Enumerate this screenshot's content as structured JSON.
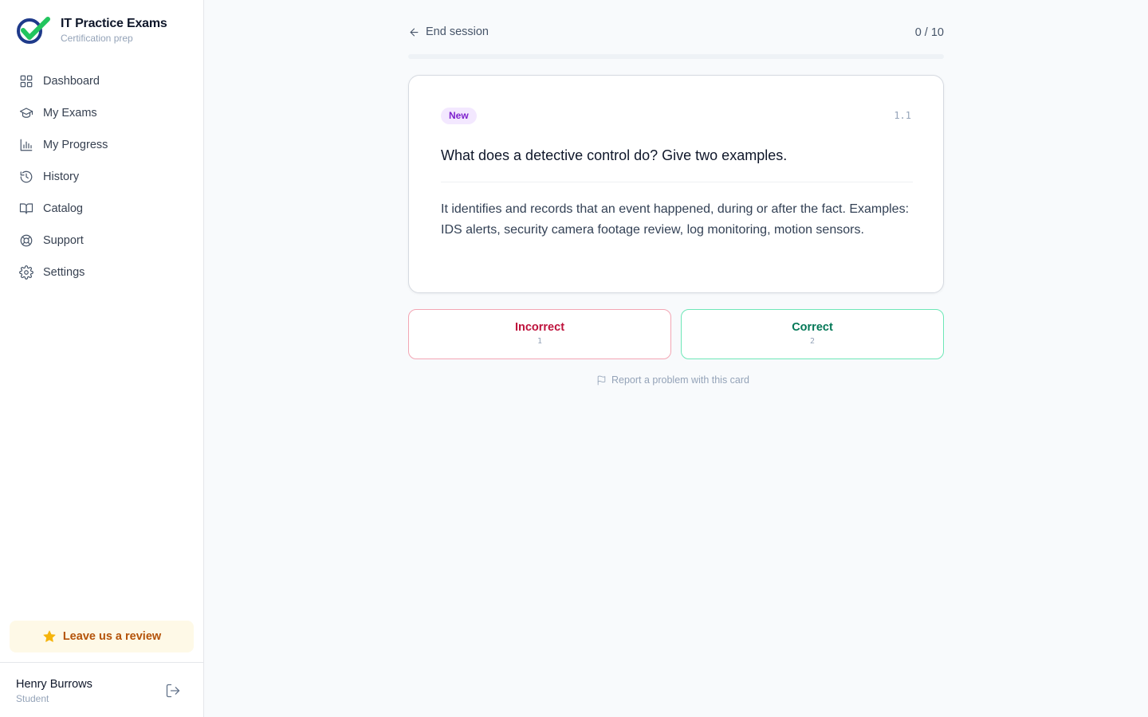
{
  "brand": {
    "title": "IT Practice Exams",
    "subtitle": "Certification prep",
    "logo_colors": [
      "#1e3a8a",
      "#22c55e"
    ]
  },
  "sidebar": {
    "items": [
      {
        "label": "Dashboard",
        "icon": "grid-icon"
      },
      {
        "label": "My Exams",
        "icon": "graduation-cap-icon"
      },
      {
        "label": "My Progress",
        "icon": "bar-chart-icon"
      },
      {
        "label": "History",
        "icon": "history-icon"
      },
      {
        "label": "Catalog",
        "icon": "book-open-icon"
      },
      {
        "label": "Support",
        "icon": "life-buoy-icon"
      },
      {
        "label": "Settings",
        "icon": "gear-icon"
      }
    ],
    "review_label": "Leave us a review",
    "review_icon": "star-icon"
  },
  "user": {
    "name": "Henry Burrows",
    "role": "Student",
    "logout_icon": "logout-icon"
  },
  "session": {
    "end_label": "End session",
    "counter": "0 / 10",
    "progress_fraction": 0
  },
  "card": {
    "badge": "New",
    "id": "1.1",
    "question": "What does a detective control do? Give two examples.",
    "answer": "It identifies and records that an event happened, during or after the fact. Examples: IDS alerts, security camera footage review, log monitoring, motion sensors."
  },
  "actions": {
    "incorrect": {
      "label": "Incorrect",
      "key": "1",
      "color": "#be123c"
    },
    "correct": {
      "label": "Correct",
      "key": "2",
      "color": "#047857"
    },
    "report_label": "Report a problem with this card"
  }
}
